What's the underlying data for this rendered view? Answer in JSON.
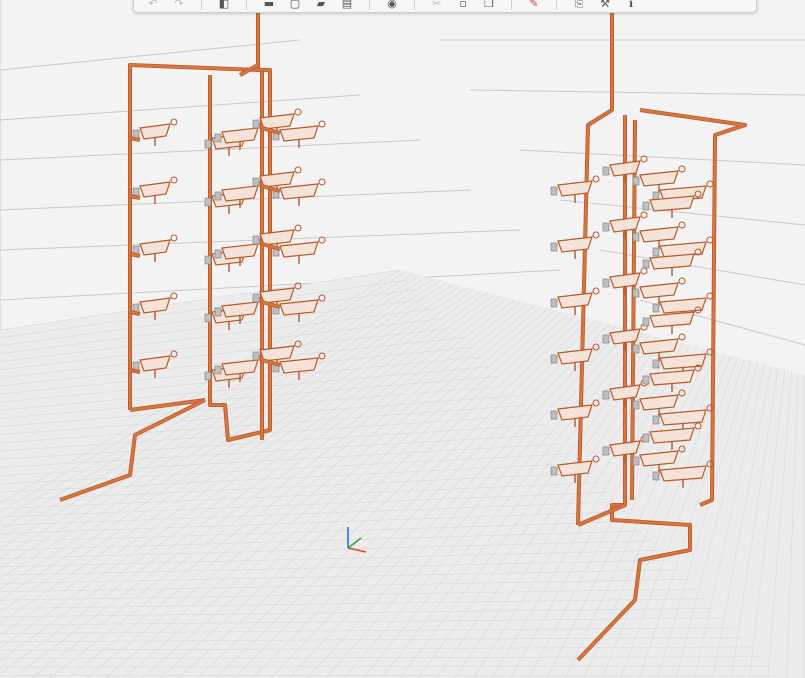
{
  "colors": {
    "background": "#f3f3f3",
    "floor": "#ececec",
    "grid": "#d8d8d8",
    "pipe": "#d9763f",
    "pipe_dark": "#b9592a",
    "wall_line": "#c9c9c9",
    "axis_x": "#e0432f",
    "axis_y": "#3aa447",
    "axis_z": "#2e6fd8"
  },
  "toolbar": {
    "buttons": [
      {
        "name": "undo-button",
        "icon": "undo-icon",
        "glyph": "↶",
        "state": "disabled"
      },
      {
        "name": "redo-button",
        "icon": "redo-icon",
        "glyph": "↷",
        "state": "disabled"
      },
      {
        "name": "mirror-button",
        "icon": "mirror-icon",
        "glyph": "◧",
        "state": "normal"
      },
      {
        "name": "box-view-button",
        "icon": "box-icon",
        "glyph": "▬",
        "state": "normal"
      },
      {
        "name": "page-button",
        "icon": "page-icon",
        "glyph": "▢",
        "state": "normal"
      },
      {
        "name": "layer-button",
        "icon": "layer-icon",
        "glyph": "▰",
        "state": "normal"
      },
      {
        "name": "stack-button",
        "icon": "stack-icon",
        "glyph": "▤",
        "state": "normal"
      },
      {
        "name": "globe-button",
        "icon": "globe-icon",
        "glyph": "◉",
        "state": "normal"
      },
      {
        "name": "cut-button",
        "icon": "scissors-icon",
        "glyph": "✂",
        "state": "disabled"
      },
      {
        "name": "copy-button",
        "icon": "copy-icon",
        "glyph": "▫",
        "state": "normal"
      },
      {
        "name": "paste-button",
        "icon": "paste-icon",
        "glyph": "❐",
        "state": "normal"
      },
      {
        "name": "draw-button",
        "icon": "pen-icon",
        "glyph": "✎",
        "state": "red"
      },
      {
        "name": "export-button",
        "icon": "export-icon",
        "glyph": "⎘",
        "state": "normal"
      },
      {
        "name": "wrench-button",
        "icon": "wrench-icon",
        "glyph": "⚒",
        "state": "normal"
      },
      {
        "name": "info-button",
        "icon": "info-icon",
        "glyph": "ℹ",
        "state": "normal"
      }
    ]
  },
  "scene": {
    "left_tower_floors": 5,
    "right_tower_floors": 6
  }
}
